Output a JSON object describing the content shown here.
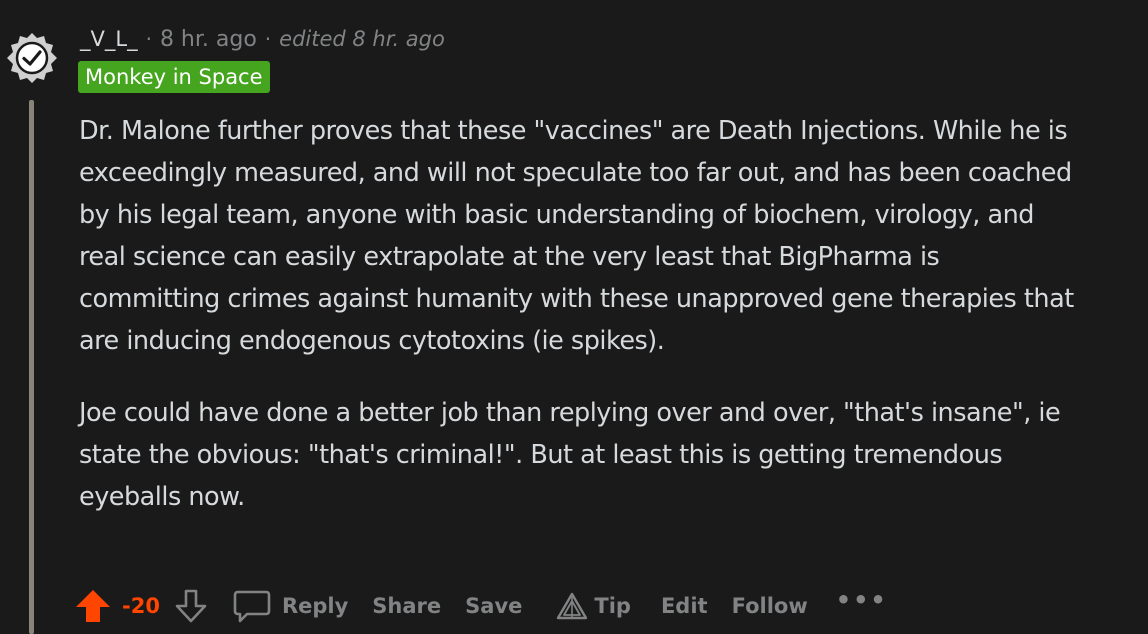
{
  "comment": {
    "username": "_V_L_",
    "separator": "·",
    "time": "8 hr. ago",
    "edited": "edited 8 hr. ago",
    "flair": "Monkey in Space",
    "flair_color": "#46a51f",
    "paragraphs": [
      "Dr. Malone further proves that these \"vaccines\" are Death Injections. While he is exceedingly measured, and will not speculate too far out, and has been coached by his legal team, anyone with basic understanding of biochem, virology, and real science can easily extrapolate at the very least that BigPharma is committing crimes against humanity with these unapproved gene therapies that are inducing endogenous cytotoxins (ie spikes).",
      "Joe could have done a better job than replying over and over, \"that's insane\", ie state the obvious: \"that's criminal!\". But at least this is getting tremendous eyeballs now."
    ]
  },
  "actions": {
    "score": "-20",
    "score_color": "#ff4500",
    "reply": "Reply",
    "share": "Share",
    "save": "Save",
    "tip": "Tip",
    "edit": "Edit",
    "follow": "Follow",
    "more": "•••"
  },
  "icons": {
    "avatar": "verified-check-avatar-icon",
    "upvote": "upvote-arrow-icon",
    "downvote": "downvote-arrow-icon",
    "reply": "speech-bubble-icon",
    "tip": "tip-triangle-icon",
    "more": "more-options-icon"
  },
  "colors": {
    "background": "#1a1a1b",
    "text": "#d7dadc",
    "muted": "#818384",
    "thread_line": "#8a8478"
  }
}
